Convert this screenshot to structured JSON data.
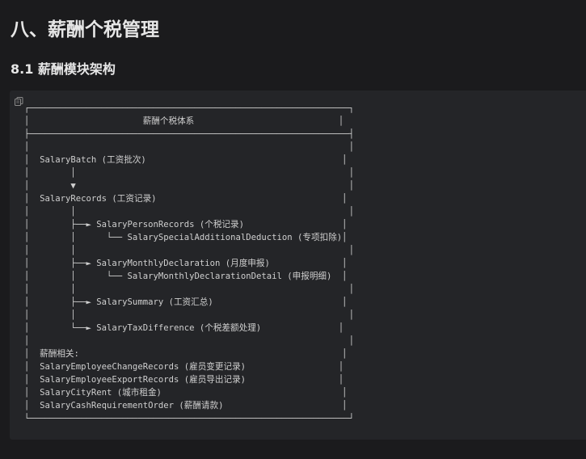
{
  "heading1": "八、薪酬个税管理",
  "heading2": "8.1 薪酬模块架构",
  "code_block": {
    "copy_icon": "copy-icon",
    "content": "┌──────────────────────────────────────────────────────────────┐\n│                      薪酬个税体系                            │\n├──────────────────────────────────────────────────────────────┤\n│                                                              │\n│  SalaryBatch (工资批次)                                      │\n│        │                                                     │\n│        ▼                                                     │\n│  SalaryRecords (工资记录)                                    │\n│        │                                                     │\n│        ├──► SalaryPersonRecords (个税记录)                   │\n│        │      └── SalarySpecialAdditionalDeduction (专项扣除)│\n│        │                                                     │\n│        ├──► SalaryMonthlyDeclaration (月度申报)              │\n│        │      └── SalaryMonthlyDeclarationDetail (申报明细)  │\n│        │                                                     │\n│        ├──► SalarySummary (工资汇总)                         │\n│        │                                                     │\n│        └──► SalaryTaxDifference (个税差额处理)               │\n│                                                              │\n│  薪酬相关:                                                   │\n│  SalaryEmployeeChangeRecords (雇员变更记录)                  │\n│  SalaryEmployeeExportRecords (雇员导出记录)                  │\n│  SalaryCityRent (城市租金)                                   │\n│  SalaryCashRequirementOrder (薪酬请款)                       │\n└──────────────────────────────────────────────────────────────┘"
  }
}
